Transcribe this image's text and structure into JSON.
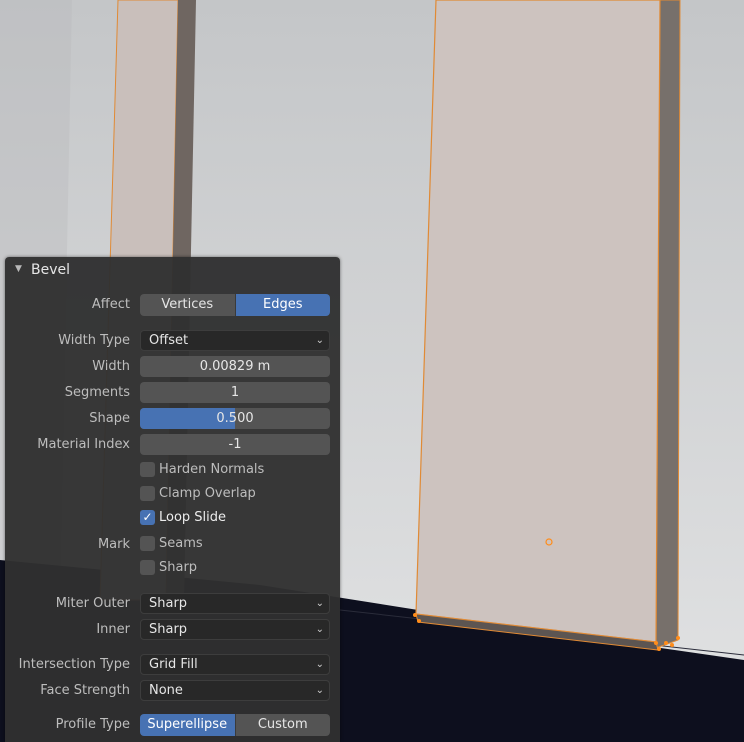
{
  "panel": {
    "title": "Bevel",
    "affect": {
      "label": "Affect",
      "options": [
        "Vertices",
        "Edges"
      ],
      "selected": "Edges"
    },
    "width_type": {
      "label": "Width Type",
      "value": "Offset"
    },
    "width": {
      "label": "Width",
      "value": "0.00829 m"
    },
    "segments": {
      "label": "Segments",
      "value": "1"
    },
    "shape": {
      "label": "Shape",
      "value": "0.500",
      "fraction": 0.5
    },
    "material_index": {
      "label": "Material Index",
      "value": "-1"
    },
    "harden_normals": {
      "label": "Harden Normals",
      "checked": false
    },
    "clamp_overlap": {
      "label": "Clamp Overlap",
      "checked": false
    },
    "loop_slide": {
      "label": "Loop Slide",
      "checked": true
    },
    "mark": {
      "label": "Mark",
      "seams": {
        "label": "Seams",
        "checked": false
      },
      "sharp": {
        "label": "Sharp",
        "checked": false
      }
    },
    "miter_outer": {
      "label": "Miter Outer",
      "value": "Sharp"
    },
    "inner": {
      "label": "Inner",
      "value": "Sharp"
    },
    "intersection_type": {
      "label": "Intersection Type",
      "value": "Grid Fill"
    },
    "face_strength": {
      "label": "Face Strength",
      "value": "None"
    },
    "profile_type": {
      "label": "Profile Type",
      "options": [
        "Superellipse",
        "Custom"
      ],
      "selected": "Superellipse"
    }
  },
  "colors": {
    "accent": "#4772b3",
    "selection": "#ff8c1a",
    "panel_bg": "#303030"
  }
}
